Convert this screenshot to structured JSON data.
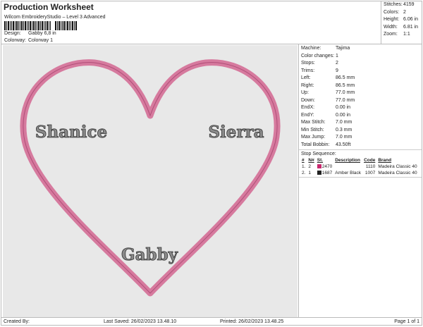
{
  "header": {
    "title": "Production Worksheet",
    "subtitle": "Wilcom EmbroideryStudio – Level 3 Advanced",
    "design_label": "Design:",
    "design": "Gabby 6,8 in",
    "colorway_label": "Colorway:",
    "colorway": "Colorway 1"
  },
  "stats": [
    {
      "k": "Stitches:",
      "v": "4159"
    },
    {
      "k": "Colors:",
      "v": "2"
    },
    {
      "k": "Height:",
      "v": "6.06 in"
    },
    {
      "k": "Width:",
      "v": "6.81 in"
    },
    {
      "k": "Zoom:",
      "v": "1:1"
    }
  ],
  "design_texts": {
    "left": "Shanice",
    "right": "Sierra",
    "bottom": "Gabby"
  },
  "colors": {
    "heart": "#d67a9e",
    "heart_edge": "#b04e78",
    "text": "#8a8a8a"
  },
  "info": [
    {
      "k": "Machine:",
      "v": "Tajima"
    },
    {
      "k": "Color changes:",
      "v": "1"
    },
    {
      "k": "Stops:",
      "v": "2"
    },
    {
      "k": "Trims:",
      "v": "9"
    },
    {
      "k": "Left:",
      "v": "86.5 mm"
    },
    {
      "k": "Right:",
      "v": "86.5 mm"
    },
    {
      "k": "Up:",
      "v": "77.0 mm"
    },
    {
      "k": "Down:",
      "v": "77.0 mm"
    },
    {
      "k": "EndX:",
      "v": "0.00 in"
    },
    {
      "k": "EndY:",
      "v": "0.00 in"
    },
    {
      "k": "Max Stitch:",
      "v": "7.0 mm"
    },
    {
      "k": "Min Stitch:",
      "v": "0.3 mm"
    },
    {
      "k": "Max Jump:",
      "v": "7.0 mm"
    },
    {
      "k": "Total Bobbin:",
      "v": "43.50ft"
    }
  ],
  "stop_sequence": {
    "title": "Stop Sequence:",
    "headers": [
      "#",
      "N#",
      "St.",
      "Description",
      "Code",
      "Brand"
    ],
    "rows": [
      {
        "num": "1.",
        "n": "2",
        "color": "#c8286e",
        "st": "2470",
        "desc": "",
        "code": "1110",
        "brand": "Madeira Classic 40"
      },
      {
        "num": "2.",
        "n": "1",
        "color": "#222222",
        "st": "1687",
        "desc": "Amber Black",
        "code": "1007",
        "brand": "Madeira Classic 40"
      }
    ]
  },
  "footer": {
    "created": "Created By:",
    "saved": "Last Saved: 26/02/2023 13.48.10",
    "printed": "Printed: 26/02/2023 13.48.25",
    "page": "Page 1 of 1"
  }
}
